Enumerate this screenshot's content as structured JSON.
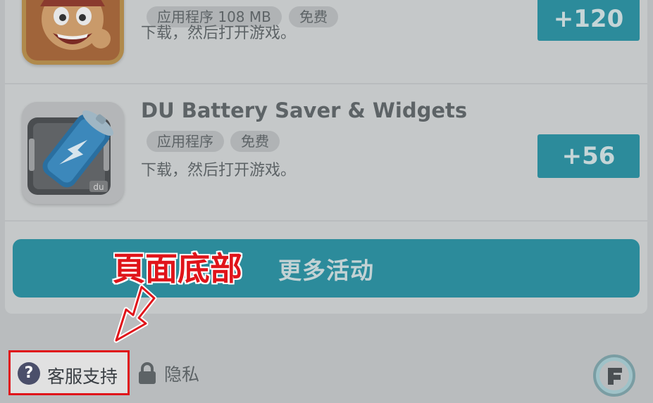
{
  "apps": [
    {
      "name": "",
      "tags": [
        "应用程序 108 MB",
        "免费"
      ],
      "description": "下载，然后打开游戏。",
      "points": "+120",
      "icon": "cartoon-pirate-icon"
    },
    {
      "name": "DU Battery Saver & Widgets",
      "tags": [
        "应用程序",
        "免费"
      ],
      "description": "下载，然后打开游戏。",
      "points": "+56",
      "icon": "battery-icon"
    }
  ],
  "more_button": {
    "label": "更多活动"
  },
  "annotation": {
    "label": "頁面底部"
  },
  "footer": {
    "support_label": "客服支持",
    "support_icon": "question-mark",
    "privacy_label": "隐私",
    "privacy_icon": "lock",
    "logo_icon": "f-logo-icon"
  },
  "colors": {
    "accent": "#2c8b9b",
    "highlight": "#e0141a",
    "background": "#b9bcbe"
  }
}
